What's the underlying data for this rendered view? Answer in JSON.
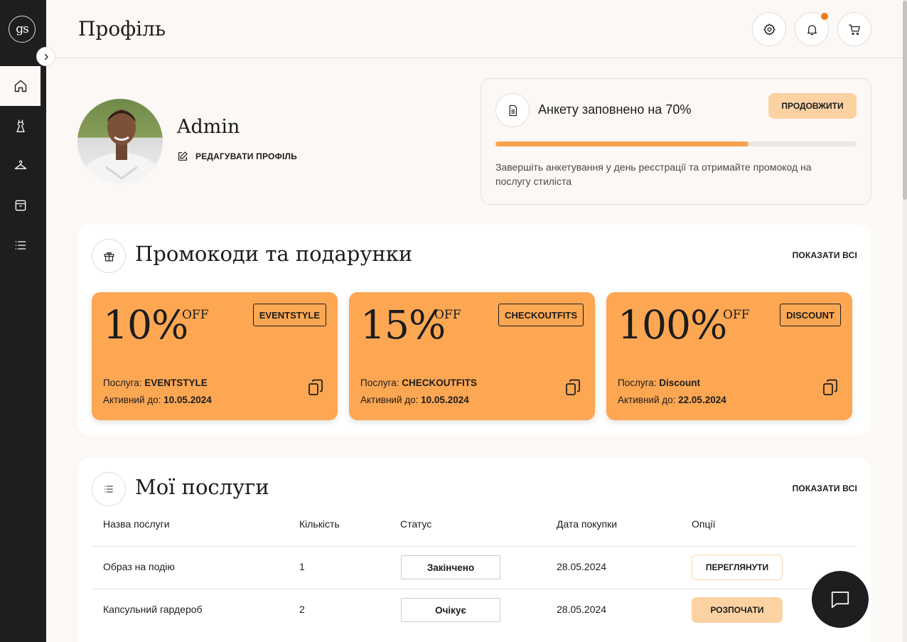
{
  "brand": {
    "logo_text": "gs"
  },
  "header": {
    "title": "Профіль"
  },
  "profile": {
    "name": "Admin",
    "edit_label": "РЕДАГУВАТИ ПРОФІЛЬ"
  },
  "questionnaire": {
    "title": "Анкету заповнено на 70%",
    "progress_percent": 70,
    "continue_label": "ПРОДОВЖИТИ",
    "text": "Завершіть анкетування у день реєстрації та отримайте промокод на послугу стиліста"
  },
  "promos": {
    "title": "Промокоди та подарунки",
    "show_all": "ПОКАЗАТИ ВСІ",
    "service_label": "Послуга:",
    "active_label": "Активний до:",
    "items": [
      {
        "percent": "10%",
        "off": "OFF",
        "code": "EVENTSTYLE",
        "service": "EVENTSTYLE",
        "date": "10.05.2024"
      },
      {
        "percent": "15%",
        "off": "OFF",
        "code": "CHECKOUTFITS",
        "service": "CHECKOUTFITS",
        "date": "10.05.2024"
      },
      {
        "percent": "100%",
        "off": "OFF",
        "code": "DISCOUNT",
        "service": "Discount",
        "date": "22.05.2024"
      }
    ]
  },
  "services": {
    "title": "Мої послуги",
    "show_all": "ПОКАЗАТИ ВСІ",
    "columns": [
      "Назва послуги",
      "Кількість",
      "Статус",
      "Дата покупки",
      "Опції"
    ],
    "rows": [
      {
        "name": "Образ на подію",
        "qty": "1",
        "status": "Закінчено",
        "date": "28.05.2024",
        "option": "ПЕРЕГЛЯНУТИ"
      },
      {
        "name": "Капсульний гардероб",
        "qty": "2",
        "status": "Очікує",
        "date": "28.05.2024",
        "option": "РОЗПОЧАТИ"
      }
    ]
  },
  "icons": {
    "sidebar": [
      "home-icon",
      "dress-icon",
      "hanger-icon",
      "box-icon",
      "list-icon"
    ],
    "header": [
      "gear-icon",
      "bell-icon",
      "cart-icon"
    ],
    "accent": "#fda753",
    "dark": "#1e1e20"
  }
}
